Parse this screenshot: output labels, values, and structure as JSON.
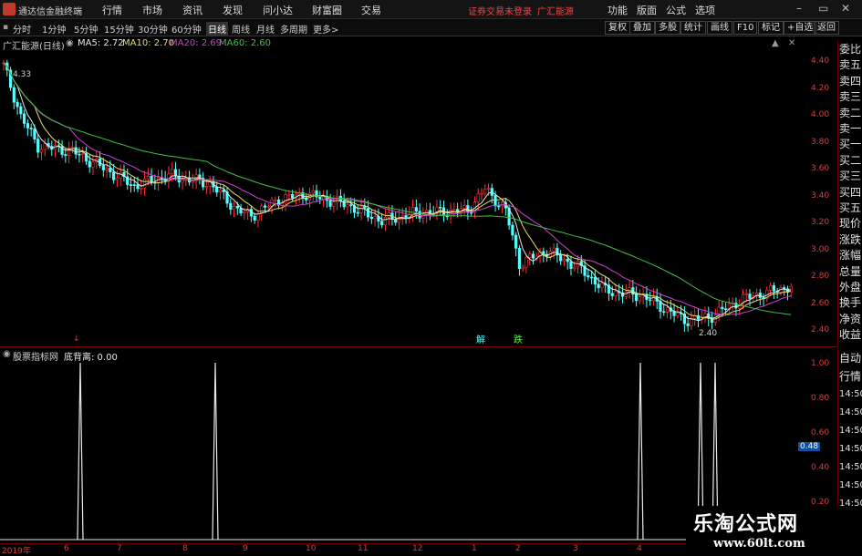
{
  "app": {
    "title": "通达信金融终端",
    "menu": [
      "行情",
      "市场",
      "资讯",
      "发现",
      "问小达",
      "财富圈",
      "交易"
    ],
    "status_left": "证券交易未登录",
    "status_right": "广汇能源",
    "menu_right": [
      "功能",
      "版面",
      "公式",
      "选项"
    ],
    "window_controls": [
      "–",
      "▭",
      "✕"
    ]
  },
  "toolbar": {
    "periods": [
      "分时",
      "1分钟",
      "5分钟",
      "15分钟",
      "30分钟",
      "60分钟",
      "日线",
      "周线",
      "月线",
      "多周期",
      "更多>"
    ],
    "active_period": "日线",
    "right_buttons": [
      "复权",
      "叠加",
      "多股",
      "统计",
      "画线",
      "F10",
      "标记",
      "+自选",
      "返回"
    ]
  },
  "chart": {
    "stock_label": "广汇能源(日线)",
    "ma": [
      {
        "label": "MA5: 2.72",
        "color": "#e8e8e8"
      },
      {
        "label": "MA10: 2.70",
        "color": "#e8e060"
      },
      {
        "label": "MA20: 2.69",
        "color": "#d040d0"
      },
      {
        "label": "MA60: 2.60",
        "color": "#40c040"
      }
    ],
    "price_ticks": [
      "4.40",
      "4.20",
      "4.00",
      "3.80",
      "3.60",
      "3.40",
      "3.20",
      "3.00",
      "2.80",
      "2.60",
      "2.40"
    ],
    "high_annotation": "4.33",
    "low_annotation": "2.40",
    "signal_marks": [
      "解",
      "跌"
    ],
    "side_labels": [
      "委比",
      "卖五",
      "卖四",
      "卖三",
      "卖二",
      "卖一",
      "买一",
      "买二",
      "买三",
      "买四",
      "买五",
      "现价",
      "涨跌",
      "涨幅",
      "总量",
      "外盘",
      "换手",
      "净资",
      "收益"
    ]
  },
  "subchart": {
    "indicator_label": "股票指标网",
    "value_label": "底背离: 0.00",
    "ticks": [
      "1.00",
      "0.80",
      "0.60",
      "0.40",
      "0.20"
    ],
    "current_value": "0.48",
    "side_labels": [
      "自动",
      "行情",
      "14:50",
      "14:50",
      "14:50",
      "14:50",
      "14:50",
      "14:50",
      "14:50",
      "14:50"
    ]
  },
  "date_axis": [
    "2019年",
    "6",
    "7",
    "8",
    "9",
    "10",
    "11",
    "12",
    "1",
    "2",
    "3",
    "4"
  ],
  "watermark": {
    "line1": "乐淘公式网",
    "line2": "www.60lt.com"
  },
  "colors": {
    "up": "#ff3030",
    "down": "#54ffff",
    "ma5": "#e8e8e8",
    "ma10": "#e8e060",
    "ma20": "#d040d0",
    "ma60": "#40c040",
    "axis": "#d04040"
  }
}
